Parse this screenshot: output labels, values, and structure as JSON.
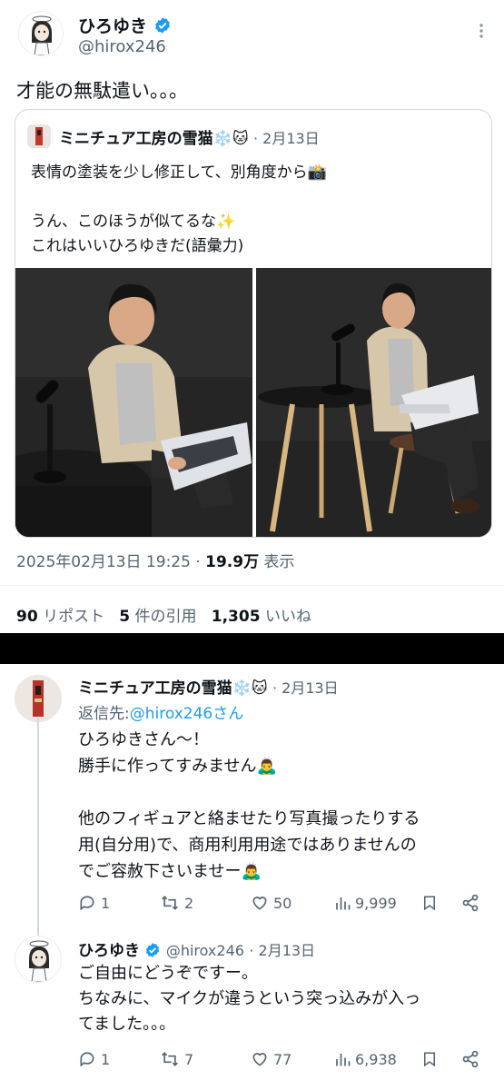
{
  "main_tweet": {
    "author_name": "ひろゆき",
    "handle": "@hirox246",
    "text": "才能の無駄遣い。。。",
    "quoted": {
      "author_name": "ミニチュア工房の雪猫",
      "name_emoji": "❄️🐱",
      "date": "· 2月13日",
      "line1": "表情の塗装を少し修正して、別角度から📸",
      "line2": "うん、このほうが似てるな✨",
      "line3": "これはいいひろゆきだ(語彙力)"
    },
    "timestamp": "2025年02月13日 19:25 ·",
    "views_count": "19.9万",
    "views_label": "表示",
    "stats": {
      "reposts_count": "90",
      "reposts_label": "リポスト",
      "quotes_count": "5",
      "quotes_label": "件の引用",
      "likes_count": "1,305",
      "likes_label": "いいね"
    }
  },
  "reply1": {
    "author_name": "ミニチュア工房の雪猫",
    "name_emoji": "❄️🐱",
    "date": "· 2月13日",
    "reply_to_prefix": "返信先:",
    "reply_to_handle": "@hirox246さん",
    "line1": "ひろゆきさん〜！",
    "line2": "勝手に作ってすみません🙇‍♂️",
    "line3": "他のフィギュアと絡ませたり写真撮ったりする",
    "line4": "用(自分用)で、商用利用用途ではありませんの",
    "line5": "でご容赦下さいませー🙇‍♂️",
    "replies": "1",
    "reposts": "2",
    "likes": "50",
    "views": "9,999"
  },
  "reply2": {
    "author_name": "ひろゆき",
    "handle": "@hirox246",
    "date": "· 2月13日",
    "line1": "ご自由にどうぞですー。",
    "line2": "ちなみに、マイクが違うという突っ込みが入っ",
    "line3": "てました。。。",
    "replies": "1",
    "reposts": "7",
    "likes": "77",
    "views": "6,938"
  },
  "colors": {
    "accent": "#1d9bf0",
    "secondary_text": "#536471",
    "border": "#cfd9de"
  }
}
